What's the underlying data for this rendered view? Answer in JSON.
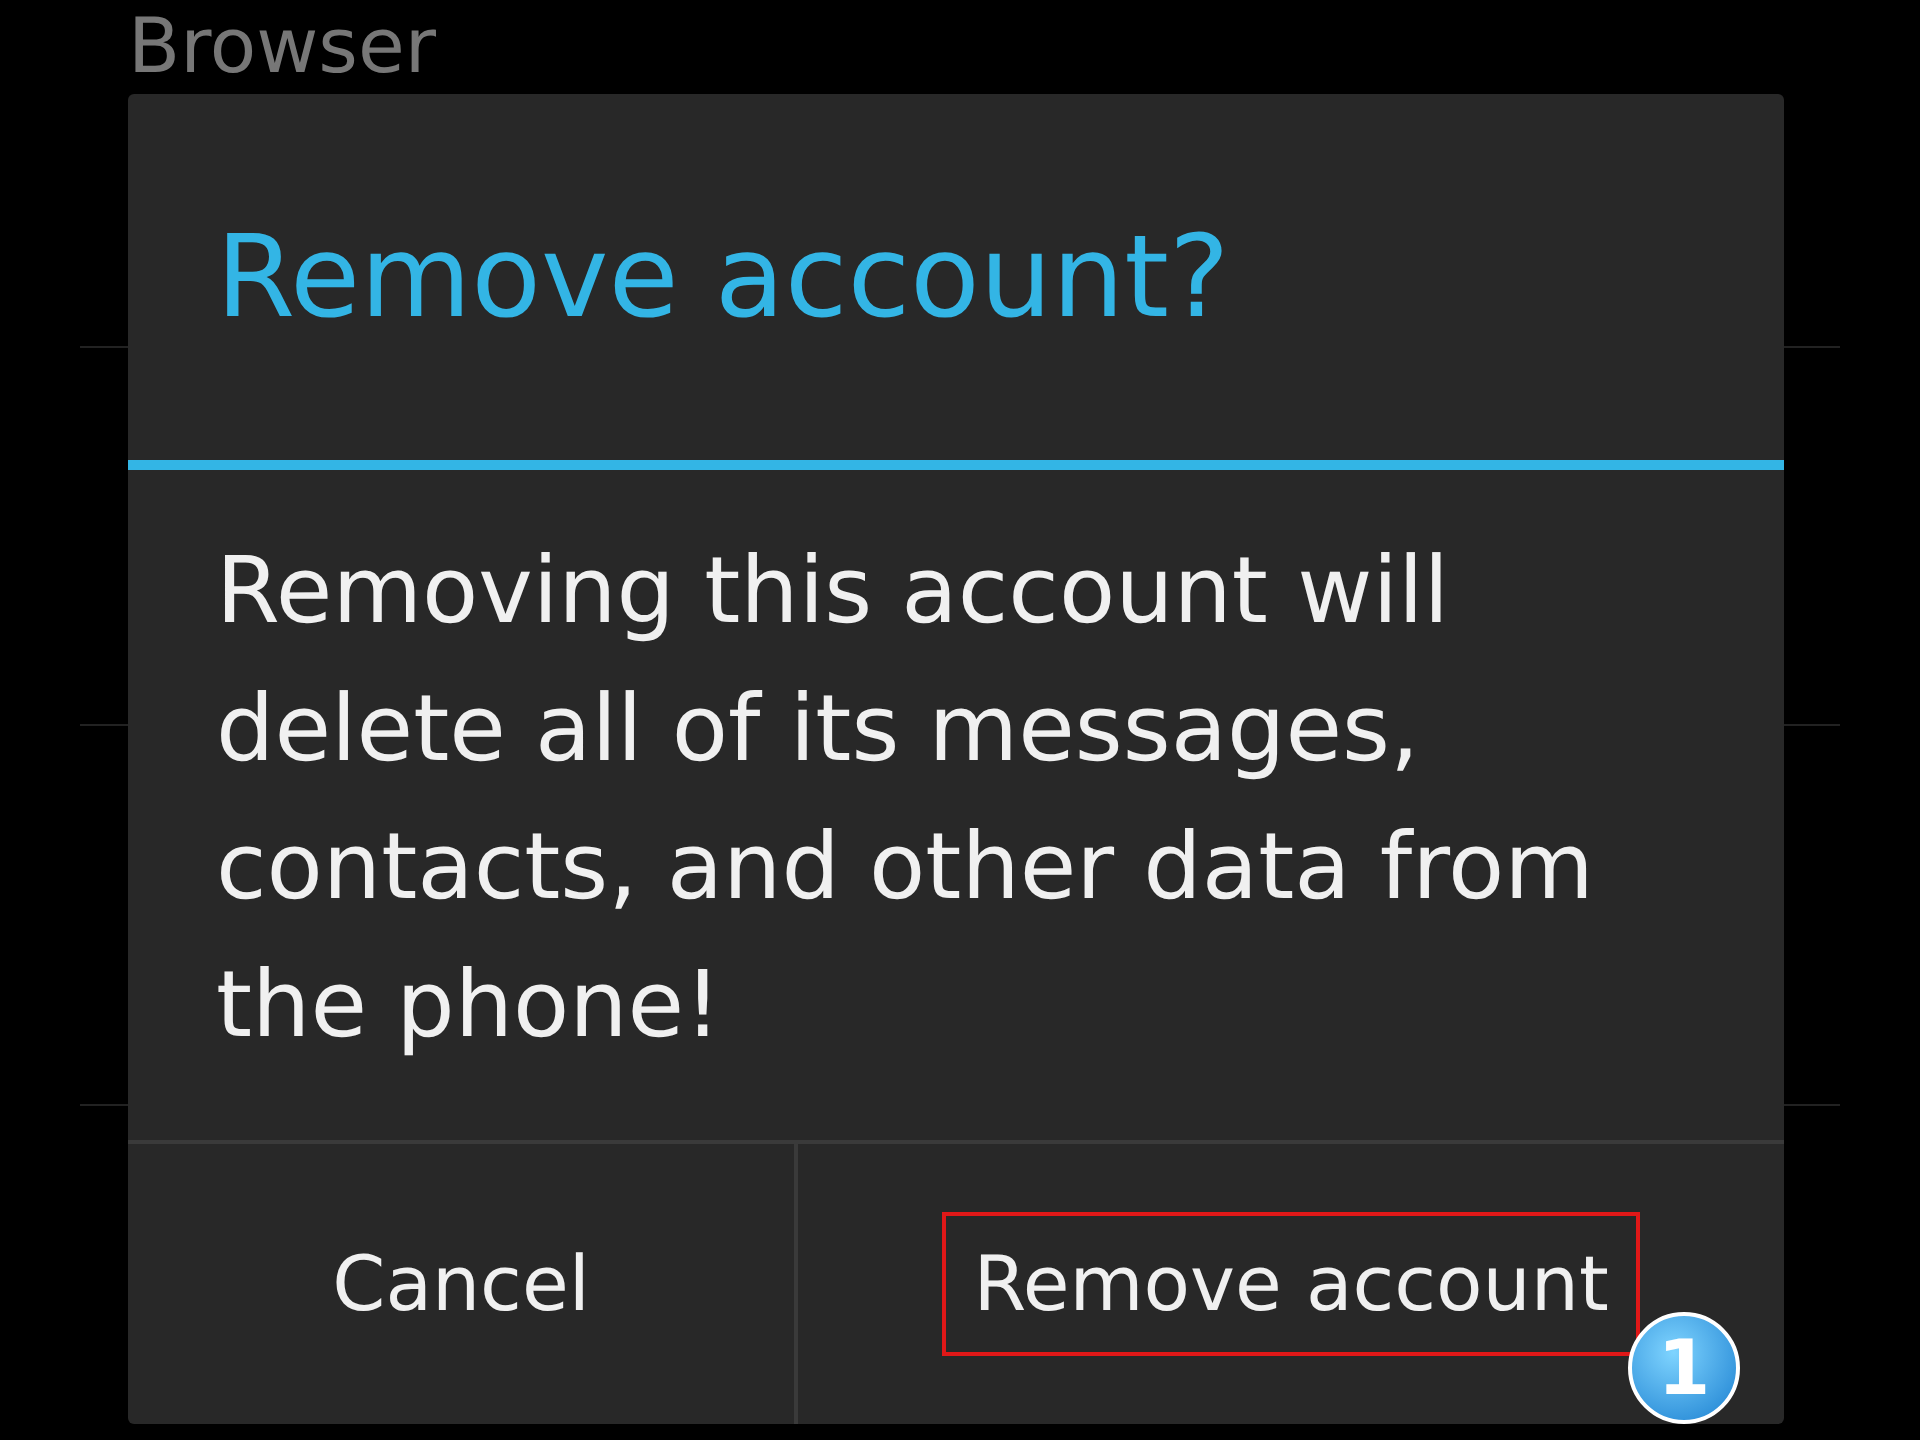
{
  "background": {
    "title": "Browser"
  },
  "dialog": {
    "title": "Remove account?",
    "message": "Removing this account will delete all of its messages, contacts, and other data from the phone!",
    "buttons": [
      {
        "label": "Cancel",
        "highlighted": false
      },
      {
        "label": "Remove account",
        "highlighted": true
      }
    ]
  },
  "annotation": {
    "badge": "1"
  }
}
